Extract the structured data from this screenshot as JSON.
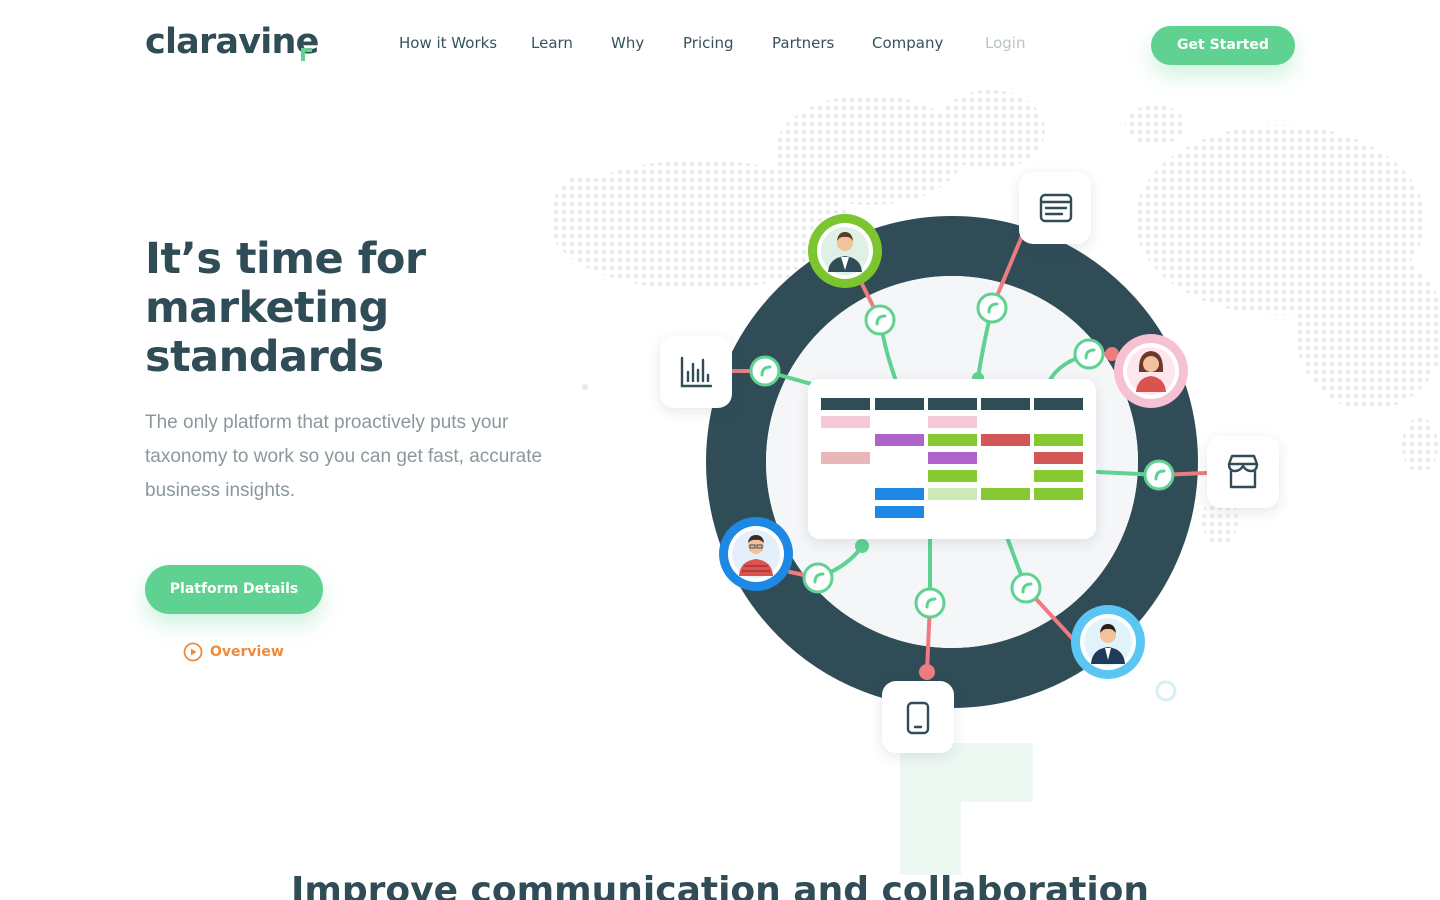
{
  "brand": {
    "name": "claravine",
    "accent_color": "#5fd291",
    "dark_color": "#2f4c57",
    "orange_color": "#f08a3b"
  },
  "nav": {
    "items": [
      {
        "label": "How it Works"
      },
      {
        "label": "Learn"
      },
      {
        "label": "Why"
      },
      {
        "label": "Pricing"
      },
      {
        "label": "Partners"
      },
      {
        "label": "Company"
      },
      {
        "label": "Login"
      }
    ],
    "cta_label": "Get Started"
  },
  "hero": {
    "title_lines": [
      "It’s time for",
      "marketing",
      "standards"
    ],
    "subtitle_lines": [
      "The only platform that proactively puts your",
      "taxonomy to work so you can get fast, accurate",
      "business insights."
    ],
    "primary_button_label": "Platform Details",
    "secondary_link_label": "Overview"
  },
  "illustration": {
    "icons": [
      "analytics-chart-icon",
      "browser-window-icon",
      "storefront-icon",
      "mobile-phone-icon"
    ],
    "avatars": [
      "man-green-avatar",
      "woman-pink-avatar",
      "man-blue-avatar",
      "man-lightblue-avatar"
    ]
  },
  "next_section": {
    "heading": "Improve communication and collaboration"
  }
}
